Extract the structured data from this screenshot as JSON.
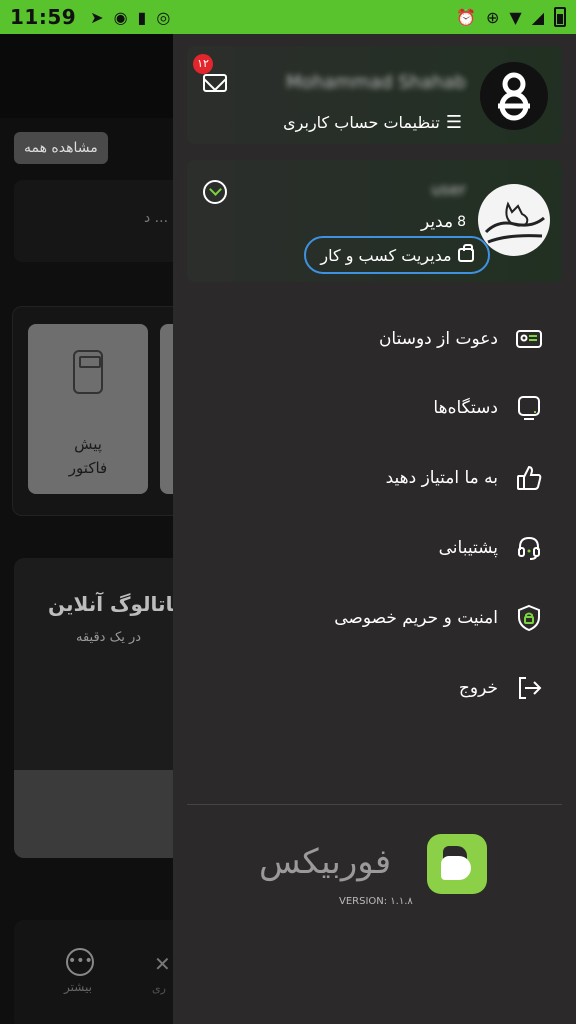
{
  "status_bar": {
    "time": "11:59",
    "left_icons": [
      "telegram-icon",
      "spotify-icon",
      "battery-saver-icon",
      "chrome-icon"
    ],
    "right_icons": [
      "alarm-icon",
      "data-saver-icon",
      "wifi-icon",
      "signal-icon",
      "battery-icon"
    ],
    "accent": "#58c32c"
  },
  "background_app": {
    "see_all": "مشاهده همه",
    "card_snippet": "د ...",
    "tile_label_line1": "پیش",
    "tile_label_line2": "فاکتور",
    "banner_title": "کاتالوگ آنلاین",
    "banner_subtitle": "در یک دقیقه",
    "nav_more": "بیشتر",
    "nav_other": "ری"
  },
  "drawer": {
    "account": {
      "name": "Mohammad Shahab",
      "settings_label": "تنظیمات حساب کاربری",
      "unread_count": "۱۲"
    },
    "business": {
      "name": "user",
      "role": "مدیر",
      "manage_label": "مدیریت کسب و کار",
      "highlight_color": "#3f92e0"
    },
    "menu": [
      {
        "label": "دعوت از دوستان",
        "icon": "invite-card-icon"
      },
      {
        "label": "دستگاه‌ها",
        "icon": "device-icon"
      },
      {
        "label": "به ما امتیاز دهید",
        "icon": "thumbs-up-icon"
      },
      {
        "label": "پشتیبانی",
        "icon": "headset-icon"
      },
      {
        "label": "امنیت و حریم خصوصی",
        "icon": "shield-lock-icon"
      },
      {
        "label": "خروج",
        "icon": "logout-icon"
      }
    ],
    "brand": {
      "name": "فوربیکس",
      "version": "VERSION: ۱.۱.۸",
      "logo_color": "#8bd046"
    }
  }
}
